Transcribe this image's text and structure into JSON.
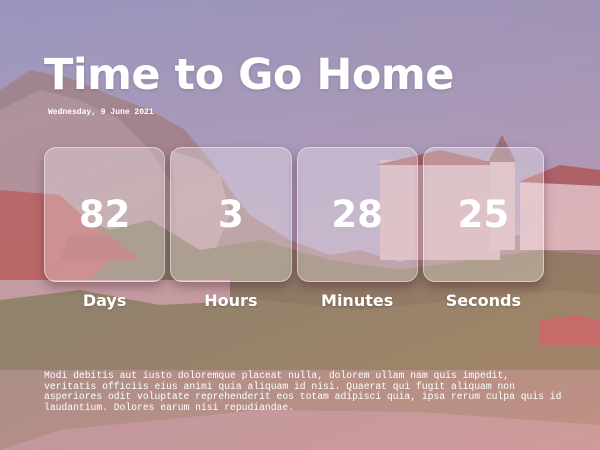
{
  "page": {
    "title": "Time to Go Home",
    "date": "Wednesday, 9 June 2021"
  },
  "countdown": {
    "units": [
      {
        "value": "82",
        "label": "Days"
      },
      {
        "value": "3",
        "label": "Hours"
      },
      {
        "value": "28",
        "label": "Minutes"
      },
      {
        "value": "25",
        "label": "Seconds"
      }
    ]
  },
  "body": {
    "text": "Modi debitis aut iusto doloremque placeat nulla, dolorem ullam nam quis impedit, veritatis officiis eius animi quia aliquam id nisi. Quaerat qui fugit aliquam non asperiores odit voluptate reprehenderit eos totam adipisci quia, ipsa rerum culpa quis id laudantium. Dolores earum nisi repudiandae."
  },
  "colors": {
    "overlay": "#b982aa",
    "text": "#ffffff"
  }
}
